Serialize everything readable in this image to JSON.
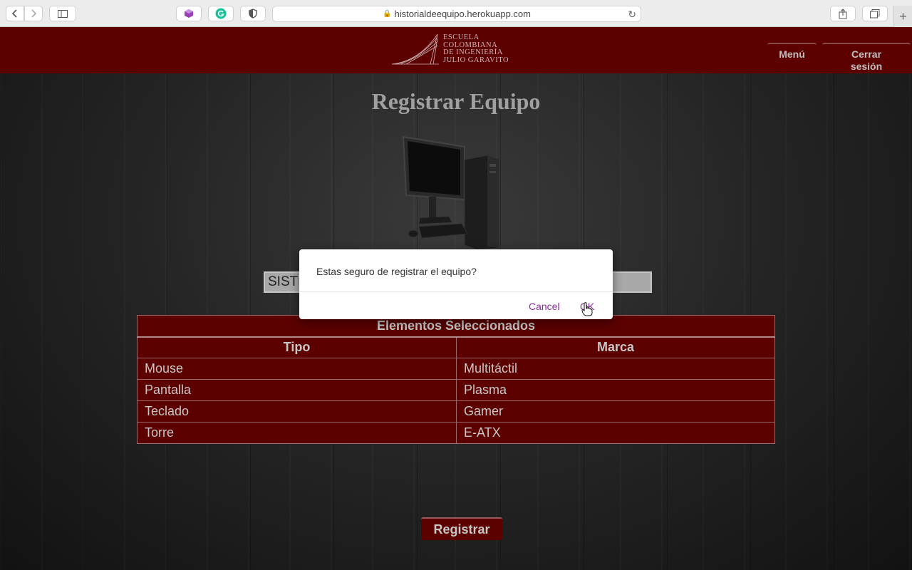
{
  "browser": {
    "url": "historialdeequipo.herokuapp.com"
  },
  "header": {
    "logo_lines": [
      "ESCUELA",
      "COLOMBIANA",
      "DE INGENIERÍA",
      "JULIO GARAVITO"
    ],
    "menu_label": "Menú",
    "logout_label_line1": "Cerrar",
    "logout_label_line2": "sesión"
  },
  "main": {
    "title": "Registrar Equipo",
    "serial_value": "SISTE",
    "table": {
      "caption": "Elementos Seleccionados",
      "headers": [
        "Tipo",
        "Marca"
      ],
      "rows": [
        [
          "Mouse",
          "Multitáctil"
        ],
        [
          "Pantalla",
          "Plasma"
        ],
        [
          "Teclado",
          "Gamer"
        ],
        [
          "Torre",
          "E-ATX"
        ]
      ]
    },
    "register_label": "Registrar"
  },
  "dialog": {
    "message": "Estas seguro de registrar el equipo?",
    "cancel_label": "Cancel",
    "ok_label": "OK"
  },
  "colors": {
    "nav": "#5c0000",
    "dialog_link": "#8a2a9b"
  }
}
